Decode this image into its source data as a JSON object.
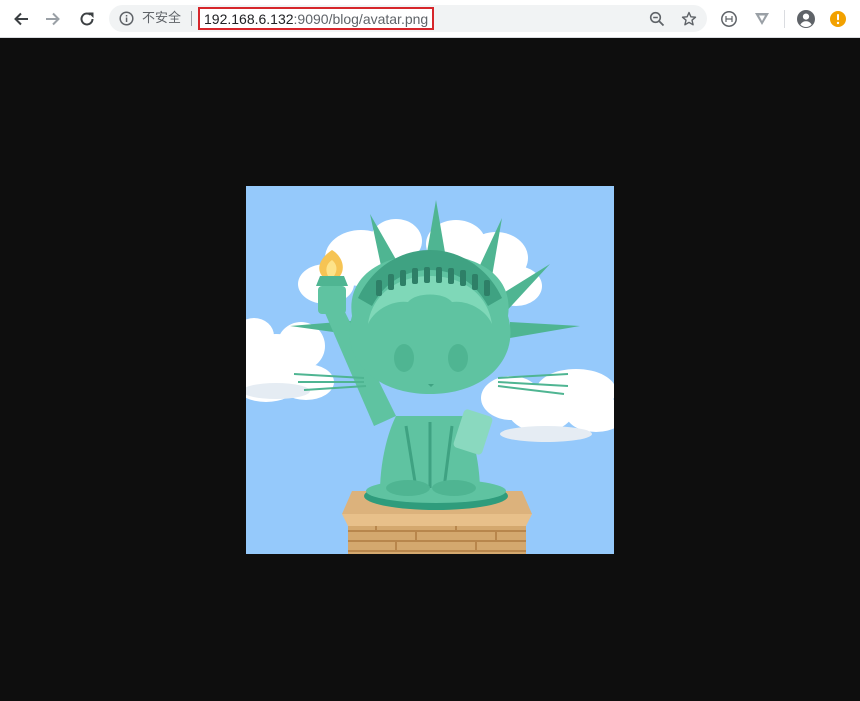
{
  "browser": {
    "security_label": "不安全",
    "url": {
      "host": "192.168.6.132",
      "rest": ":9090/blog/avatar.png"
    }
  },
  "icons": {
    "back": "arrow-left-icon",
    "forward": "arrow-right-icon",
    "reload": "reload-icon",
    "info": "info-icon",
    "zoom": "zoom-out-icon",
    "bookmark": "star-icon",
    "extension1": "clipboard-extension-icon",
    "extension2": "triangle-extension-icon",
    "profile": "account-icon",
    "update": "update-alert-icon"
  },
  "image": {
    "subject": "Octocat dressed as the Statue of Liberty on a pedestal against a blue sky with clouds"
  },
  "colors": {
    "page_background": "#0e0e0e",
    "url_highlight": "#d6262b",
    "sky": "#95c9fb",
    "statue": "#6fd0b0",
    "update_badge": "#f2a100"
  }
}
